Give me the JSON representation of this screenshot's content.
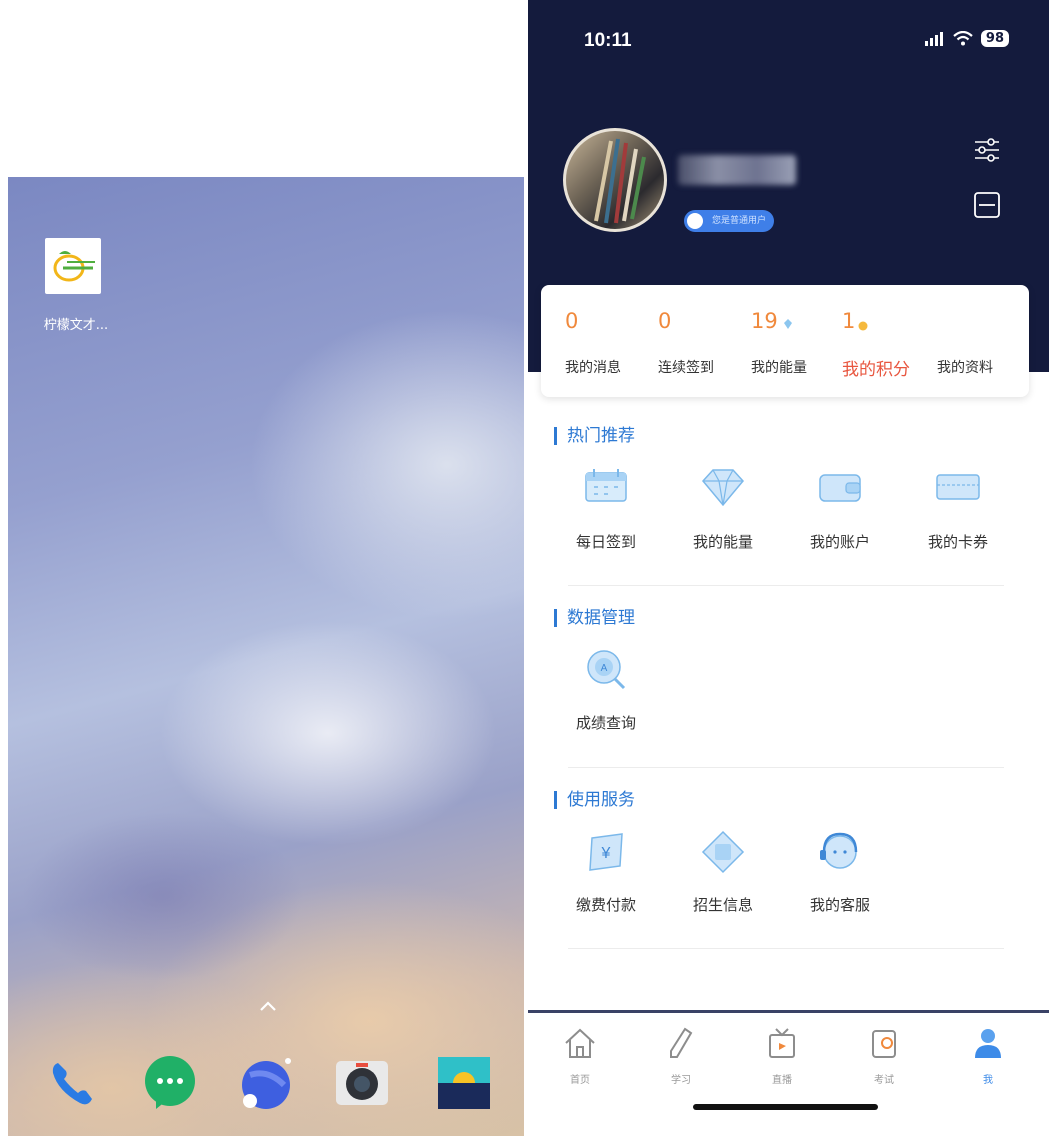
{
  "android": {
    "app_label": "柠檬文才...",
    "dock": [
      "phone-icon",
      "messages-icon",
      "browser-icon",
      "camera-icon",
      "gallery-icon"
    ]
  },
  "phone": {
    "status": {
      "time": "10:11",
      "battery": "98"
    },
    "user": {
      "badge": "您是普通用户"
    },
    "stats": [
      {
        "value": "0",
        "label": "我的消息"
      },
      {
        "value": "0",
        "label": "连续签到"
      },
      {
        "value": "19",
        "label": "我的能量"
      },
      {
        "value": "1",
        "label": "我的积分"
      },
      {
        "value": "",
        "label": "我的资料"
      }
    ],
    "sections": [
      {
        "title": "热门推荐",
        "items": [
          "每日签到",
          "我的能量",
          "我的账户",
          "我的卡券"
        ]
      },
      {
        "title": "数据管理",
        "items": [
          "成绩查询"
        ]
      },
      {
        "title": "使用服务",
        "items": [
          "缴费付款",
          "招生信息",
          "我的客服"
        ]
      }
    ],
    "tabbar": [
      "首页",
      "学习",
      "直播",
      "考试",
      "我"
    ],
    "colors": {
      "header": "#141b3d",
      "accent": "#2d79d3",
      "points": "#e8563f",
      "stat": "#f0893c"
    }
  }
}
